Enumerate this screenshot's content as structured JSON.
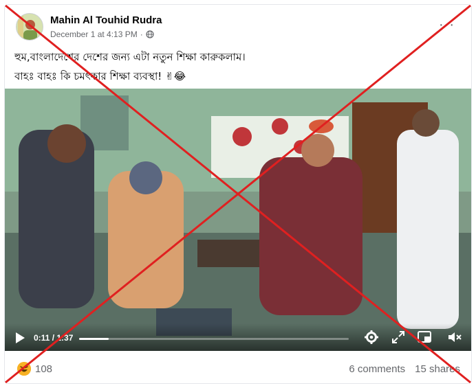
{
  "post": {
    "author": "Mahin Al Touhid Rudra",
    "timestamp": "December 1 at 4:13 PM",
    "dot": "·",
    "more_label": "···",
    "text_line1": "হুম,বাংলাদেশের দেশের জন্য এটা নতুন শিক্ষা কারুকলাম।",
    "text_line2": "বাহঃ বাহঃ কি চমৎকার শিক্ষা ব্যবস্থা! ✌😂"
  },
  "video": {
    "current_time": "0:11 / 1:37",
    "progress": 0.11
  },
  "footer": {
    "reaction_count": "108",
    "comments": "6 comments",
    "shares": "15 shares"
  },
  "colors": {
    "xmark": "#e02020",
    "progress": "#ffffff"
  },
  "icons": [
    "globe-icon",
    "more-icon",
    "play-icon",
    "settings-icon",
    "fullscreen-icon",
    "pip-icon",
    "volume-icon",
    "haha-icon"
  ]
}
